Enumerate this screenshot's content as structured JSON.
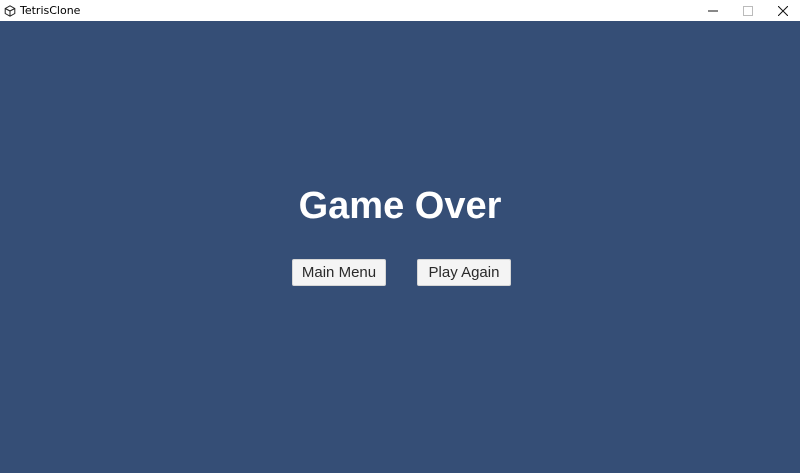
{
  "window": {
    "title": "TetrisClone",
    "app_icon": "unity-icon",
    "controls": [
      "minimize-icon",
      "maximize-icon",
      "close-icon"
    ]
  },
  "game": {
    "background_color": "#354e76",
    "heading": "Game Over",
    "buttons": {
      "main_menu": "Main Menu",
      "play_again": "Play Again"
    }
  }
}
